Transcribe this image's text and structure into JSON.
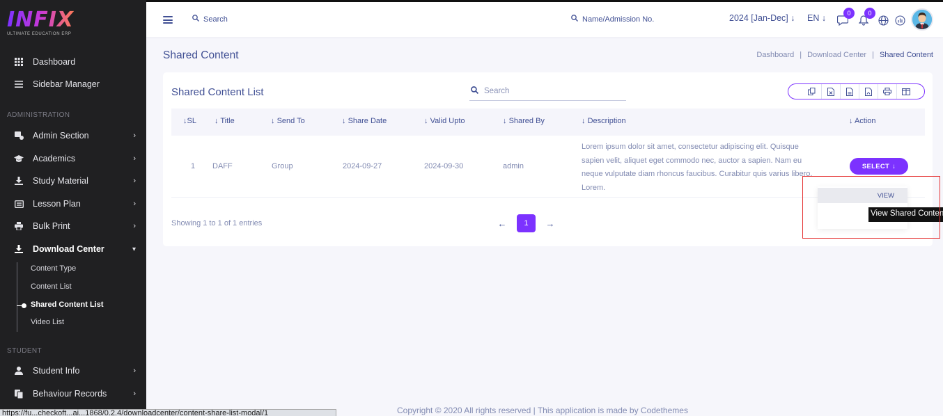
{
  "brand": {
    "name": "INFIX",
    "tagline": "ULTIMATE EDUCATION ERP"
  },
  "sidebar": {
    "items": [
      {
        "label": "Dashboard",
        "icon": "grid-icon"
      },
      {
        "label": "Sidebar Manager",
        "icon": "bars-icon"
      }
    ],
    "section_admin": "ADMINISTRATION",
    "admin_items": [
      {
        "label": "Admin Section",
        "icon": "admin-icon"
      },
      {
        "label": "Academics",
        "icon": "graduation-cap-icon"
      },
      {
        "label": "Study Material",
        "icon": "download-icon"
      },
      {
        "label": "Lesson Plan",
        "icon": "list-icon"
      },
      {
        "label": "Bulk Print",
        "icon": "print-icon"
      },
      {
        "label": "Download Center",
        "icon": "download-icon"
      }
    ],
    "download_sub": [
      {
        "label": "Content Type"
      },
      {
        "label": "Content List"
      },
      {
        "label": "Shared Content List"
      },
      {
        "label": "Video List"
      }
    ],
    "section_student": "STUDENT",
    "student_items": [
      {
        "label": "Student Info",
        "icon": "user-icon"
      },
      {
        "label": "Behaviour Records",
        "icon": "records-icon"
      }
    ]
  },
  "header": {
    "search_placeholder": "Search",
    "name_search_placeholder": "Name/Admission No.",
    "year": "2024 [Jan-Dec]",
    "lang": "EN",
    "message_count": "0",
    "notification_count": "0"
  },
  "page": {
    "title": "Shared Content",
    "breadcrumb": [
      "Dashboard",
      "Download Center",
      "Shared Content"
    ]
  },
  "table": {
    "title": "Shared Content List",
    "search_placeholder": "Search",
    "columns": [
      "SL",
      "Title",
      "Send To",
      "Share Date",
      "Valid Upto",
      "Shared By",
      "Description",
      "Action"
    ],
    "rows": [
      {
        "sl": "1",
        "title": "DAFF",
        "send_to": "Group",
        "share_date": "2024-09-27",
        "valid_upto": "2024-09-30",
        "shared_by": "admin",
        "description": "Lorem ipsum dolor sit amet, consectetur adipiscing elit. Quisque sapien velit, aliquet eget commodo nec, auctor a sapien. Nam eu neque vulputate diam rhoncus faucibus. Curabitur quis varius libero. Lorem.",
        "action": "SELECT"
      }
    ],
    "showing": "Showing 1 to 1 of 1 entries",
    "current_page": "1"
  },
  "dropdown": {
    "item": "VIEW",
    "tooltip": "View Shared Content"
  },
  "footer": "Copyright © 2020 All rights reserved | This application is made by Codethemes",
  "status_url": "https://fu...checkoft...ai...1868/0.2.4/downloadcenter/content-share-list-modal/1"
}
